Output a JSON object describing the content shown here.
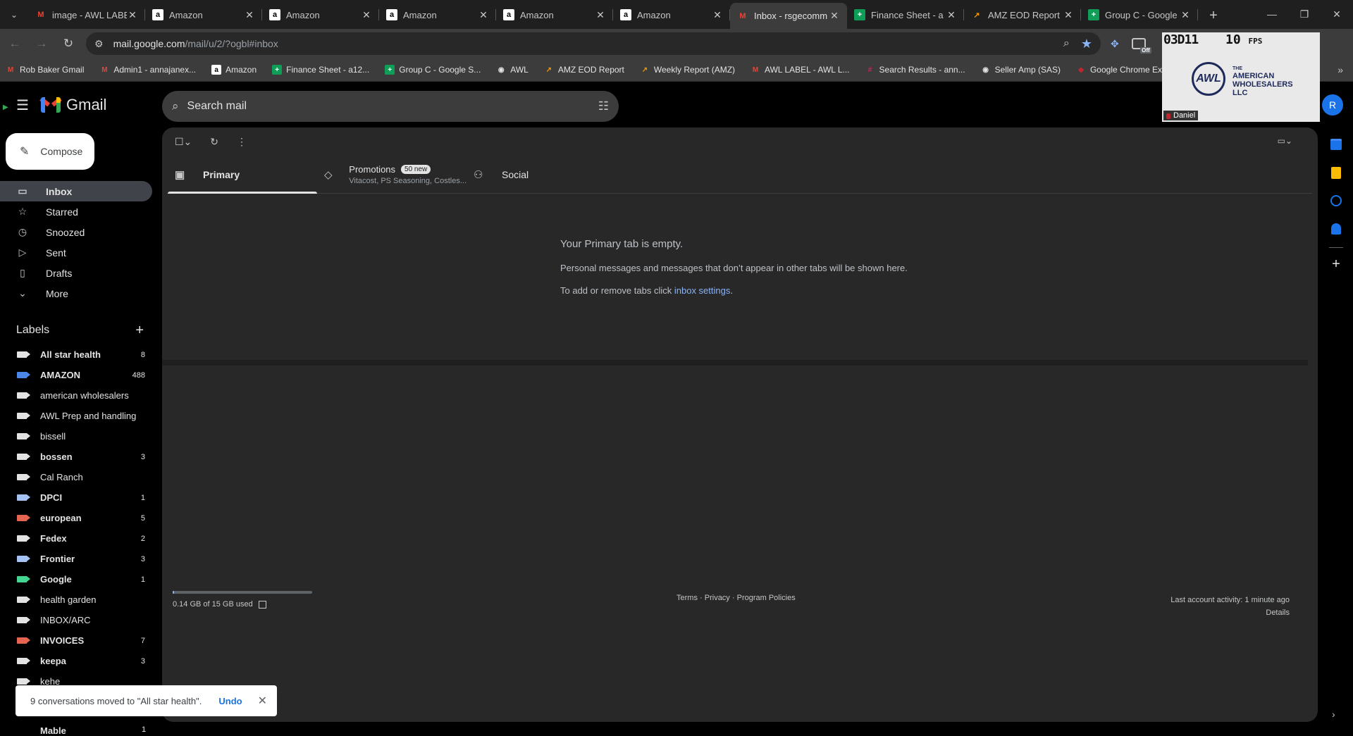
{
  "browser": {
    "tabs": [
      {
        "title": "image - AWL LABEL",
        "icon": "gmail-m",
        "active": false
      },
      {
        "title": "Amazon",
        "icon": "amazon-a",
        "active": false
      },
      {
        "title": "Amazon",
        "icon": "amazon-a",
        "active": false
      },
      {
        "title": "Amazon",
        "icon": "amazon-a",
        "active": false
      },
      {
        "title": "Amazon",
        "icon": "amazon-a",
        "active": false
      },
      {
        "title": "Amazon",
        "icon": "amazon-a",
        "active": false
      },
      {
        "title": "Inbox - rsgecomm",
        "icon": "gmail-m",
        "active": true
      },
      {
        "title": "Finance Sheet - a",
        "icon": "sheets-plus",
        "active": false
      },
      {
        "title": "AMZ EOD Report",
        "icon": "custom-arrow",
        "active": false
      },
      {
        "title": "Group C - Google",
        "icon": "sheets-plus",
        "active": false
      }
    ],
    "url_host": "mail.google.com",
    "url_path": "/mail/u/2/?ogbl#inbox",
    "bookmarks": [
      {
        "label": "Rob Baker Gmail",
        "icon": "gmail-m"
      },
      {
        "label": "Admin1 - annajanex...",
        "icon": "gmail-m"
      },
      {
        "label": "Amazon",
        "icon": "amazon-a"
      },
      {
        "label": "Finance Sheet - a12...",
        "icon": "sheets-plus"
      },
      {
        "label": "Group C - Google S...",
        "icon": "sheets-plus"
      },
      {
        "label": "AWL",
        "icon": "globe"
      },
      {
        "label": "AMZ EOD Report",
        "icon": "custom-arrow"
      },
      {
        "label": "Weekly Report (AMZ)",
        "icon": "custom-arrow"
      },
      {
        "label": "AWL LABEL - AWL L...",
        "icon": "gmail-m"
      },
      {
        "label": "Search Results - ann...",
        "icon": "slack-grid"
      },
      {
        "label": "Seller Amp (SAS)",
        "icon": "globe"
      },
      {
        "label": "Google Chrome Ext...",
        "icon": "extension"
      }
    ],
    "extension_badge": "Off"
  },
  "overlay": {
    "code": "03D11",
    "fps_value": "10",
    "fps_unit": "FPS",
    "logo_text": "AWL",
    "company_the": "THE",
    "company_line1": "AMERICAN",
    "company_line2": "WHOLESALERS",
    "company_line3": "LLC",
    "person": "Daniel"
  },
  "gmail": {
    "app_name": "Gmail",
    "search_placeholder": "Search mail",
    "avatar_letter": "R",
    "compose_label": "Compose",
    "nav": [
      {
        "label": "Inbox",
        "icon": "inbox-icon",
        "glyph": "▭",
        "active": true
      },
      {
        "label": "Starred",
        "icon": "star-icon",
        "glyph": "☆",
        "active": false
      },
      {
        "label": "Snoozed",
        "icon": "clock-icon",
        "glyph": "◷",
        "active": false
      },
      {
        "label": "Sent",
        "icon": "send-icon",
        "glyph": "▷",
        "active": false
      },
      {
        "label": "Drafts",
        "icon": "draft-icon",
        "glyph": "▯",
        "active": false
      },
      {
        "label": "More",
        "icon": "chevron-down-icon",
        "glyph": "⌄",
        "active": false
      }
    ],
    "labels_title": "Labels",
    "labels": [
      {
        "name": "All star health",
        "count": "8",
        "bold": true,
        "color": "#e3e3e3"
      },
      {
        "name": "AMAZON",
        "count": "488",
        "bold": true,
        "color": "#4986e7"
      },
      {
        "name": "american wholesalers",
        "count": "",
        "bold": false,
        "color": "#e3e3e3"
      },
      {
        "name": "AWL Prep and handling",
        "count": "",
        "bold": false,
        "color": "#e3e3e3"
      },
      {
        "name": "bissell",
        "count": "",
        "bold": false,
        "color": "#e3e3e3"
      },
      {
        "name": "bossen",
        "count": "3",
        "bold": true,
        "color": "#e3e3e3"
      },
      {
        "name": "Cal Ranch",
        "count": "",
        "bold": false,
        "color": "#e3e3e3"
      },
      {
        "name": "DPCI",
        "count": "1",
        "bold": true,
        "color": "#a4c2f4"
      },
      {
        "name": "european",
        "count": "5",
        "bold": true,
        "color": "#e66550"
      },
      {
        "name": "Fedex",
        "count": "2",
        "bold": true,
        "color": "#e3e3e3"
      },
      {
        "name": "Frontier",
        "count": "3",
        "bold": true,
        "color": "#a4c2f4"
      },
      {
        "name": "Google",
        "count": "1",
        "bold": true,
        "color": "#43d692"
      },
      {
        "name": "health garden",
        "count": "",
        "bold": false,
        "color": "#e3e3e3"
      },
      {
        "name": "INBOX/ARC",
        "count": "",
        "bold": false,
        "color": "#e3e3e3"
      },
      {
        "name": "INVOICES",
        "count": "7",
        "bold": true,
        "color": "#e66550"
      },
      {
        "name": "keepa",
        "count": "3",
        "bold": true,
        "color": "#e3e3e3"
      },
      {
        "name": "kehe",
        "count": "",
        "bold": false,
        "color": "#e3e3e3"
      }
    ],
    "cutoff_label": "Mable",
    "cutoff_count": "1",
    "category_tabs": {
      "primary": "Primary",
      "promotions": "Promotions",
      "promotions_badge": "50 new",
      "promotions_snippet": "Vitacost, PS Seasoning, Costles...",
      "social": "Social"
    },
    "empty": {
      "heading": "Your Primary tab is empty.",
      "line1": "Personal messages and messages that don’t appear in other tabs will be shown here.",
      "line2_prefix": "To add or remove tabs click ",
      "line2_link": "inbox settings",
      "line2_suffix": "."
    },
    "footer": {
      "storage": "0.14 GB of 15 GB used",
      "storage_fraction": 0.0093,
      "terms": "Terms",
      "privacy": "Privacy",
      "policies": "Program Policies",
      "dot": "·",
      "activity": "Last account activity: 1 minute ago",
      "details": "Details"
    },
    "toast": {
      "message": "9 conversations moved to \"All star health\".",
      "undo": "Undo"
    }
  }
}
